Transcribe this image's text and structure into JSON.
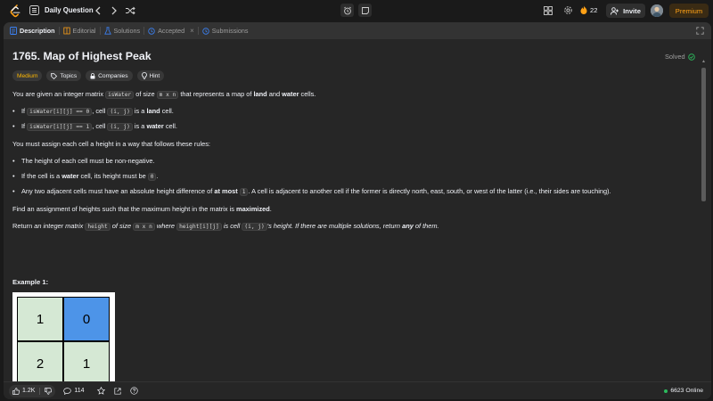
{
  "topbar": {
    "daily_label": "Daily Question",
    "streak_count": "22",
    "invite_label": "Invite",
    "premium_label": "Premium"
  },
  "tabs": [
    {
      "label": "Description",
      "icon": "description-icon",
      "active": true
    },
    {
      "label": "Editorial",
      "icon": "book-icon",
      "active": false
    },
    {
      "label": "Solutions",
      "icon": "flask-icon",
      "active": false
    },
    {
      "label": "Accepted",
      "icon": "history-icon",
      "active": false
    },
    {
      "label": "Submissions",
      "icon": "history-icon",
      "active": false
    }
  ],
  "problem": {
    "title": "1765. Map of Highest Peak",
    "status": "Solved",
    "difficulty": "Medium",
    "chips": [
      "Topics",
      "Companies",
      "Hint"
    ]
  },
  "body": {
    "intro": [
      "You are given an integer matrix ",
      "isWater",
      " of size ",
      "m x n",
      " that represents a map of ",
      "land",
      " and ",
      "water",
      " cells."
    ],
    "bullet1": [
      "If ",
      "isWater[i][j] == 0",
      ", cell ",
      "(i, j)",
      " is a ",
      "land",
      " cell."
    ],
    "bullet2": [
      "If ",
      "isWater[i][j] == 1",
      ", cell ",
      "(i, j)",
      " is a ",
      "water",
      " cell."
    ],
    "rules_intro": "You must assign each cell a height in a way that follows these rules:",
    "rule1": "The height of each cell must be non-negative.",
    "rule2": [
      "If the cell is a ",
      "water",
      " cell, its height must be ",
      "0",
      "."
    ],
    "rule3": [
      "Any two adjacent cells must have an absolute height difference of ",
      "at most",
      " ",
      "1",
      ". A cell is adjacent to another cell if the former is directly north, east, south, or west of the latter (i.e., their sides are touching)."
    ],
    "find": [
      "Find an assignment of heights such that the maximum height in the matrix is ",
      "maximized",
      "."
    ],
    "return": [
      "Return ",
      "an integer matrix ",
      "height",
      " of size ",
      "m x n",
      " where ",
      "height[i][j]",
      " is cell ",
      "(i, j)",
      "'s height. If there are multiple solutions, return ",
      "any",
      " of them."
    ]
  },
  "example": {
    "title": "Example 1:",
    "grid": [
      [
        "1",
        "0"
      ],
      [
        "2",
        "1"
      ]
    ]
  },
  "colors": {
    "land": "#d5e8d4",
    "water": "#4d94e8",
    "accent": "#ffa116",
    "solved": "#2cbb5d"
  },
  "footer": {
    "likes": "1.2K",
    "comments": "114",
    "online": "6623 Online"
  }
}
